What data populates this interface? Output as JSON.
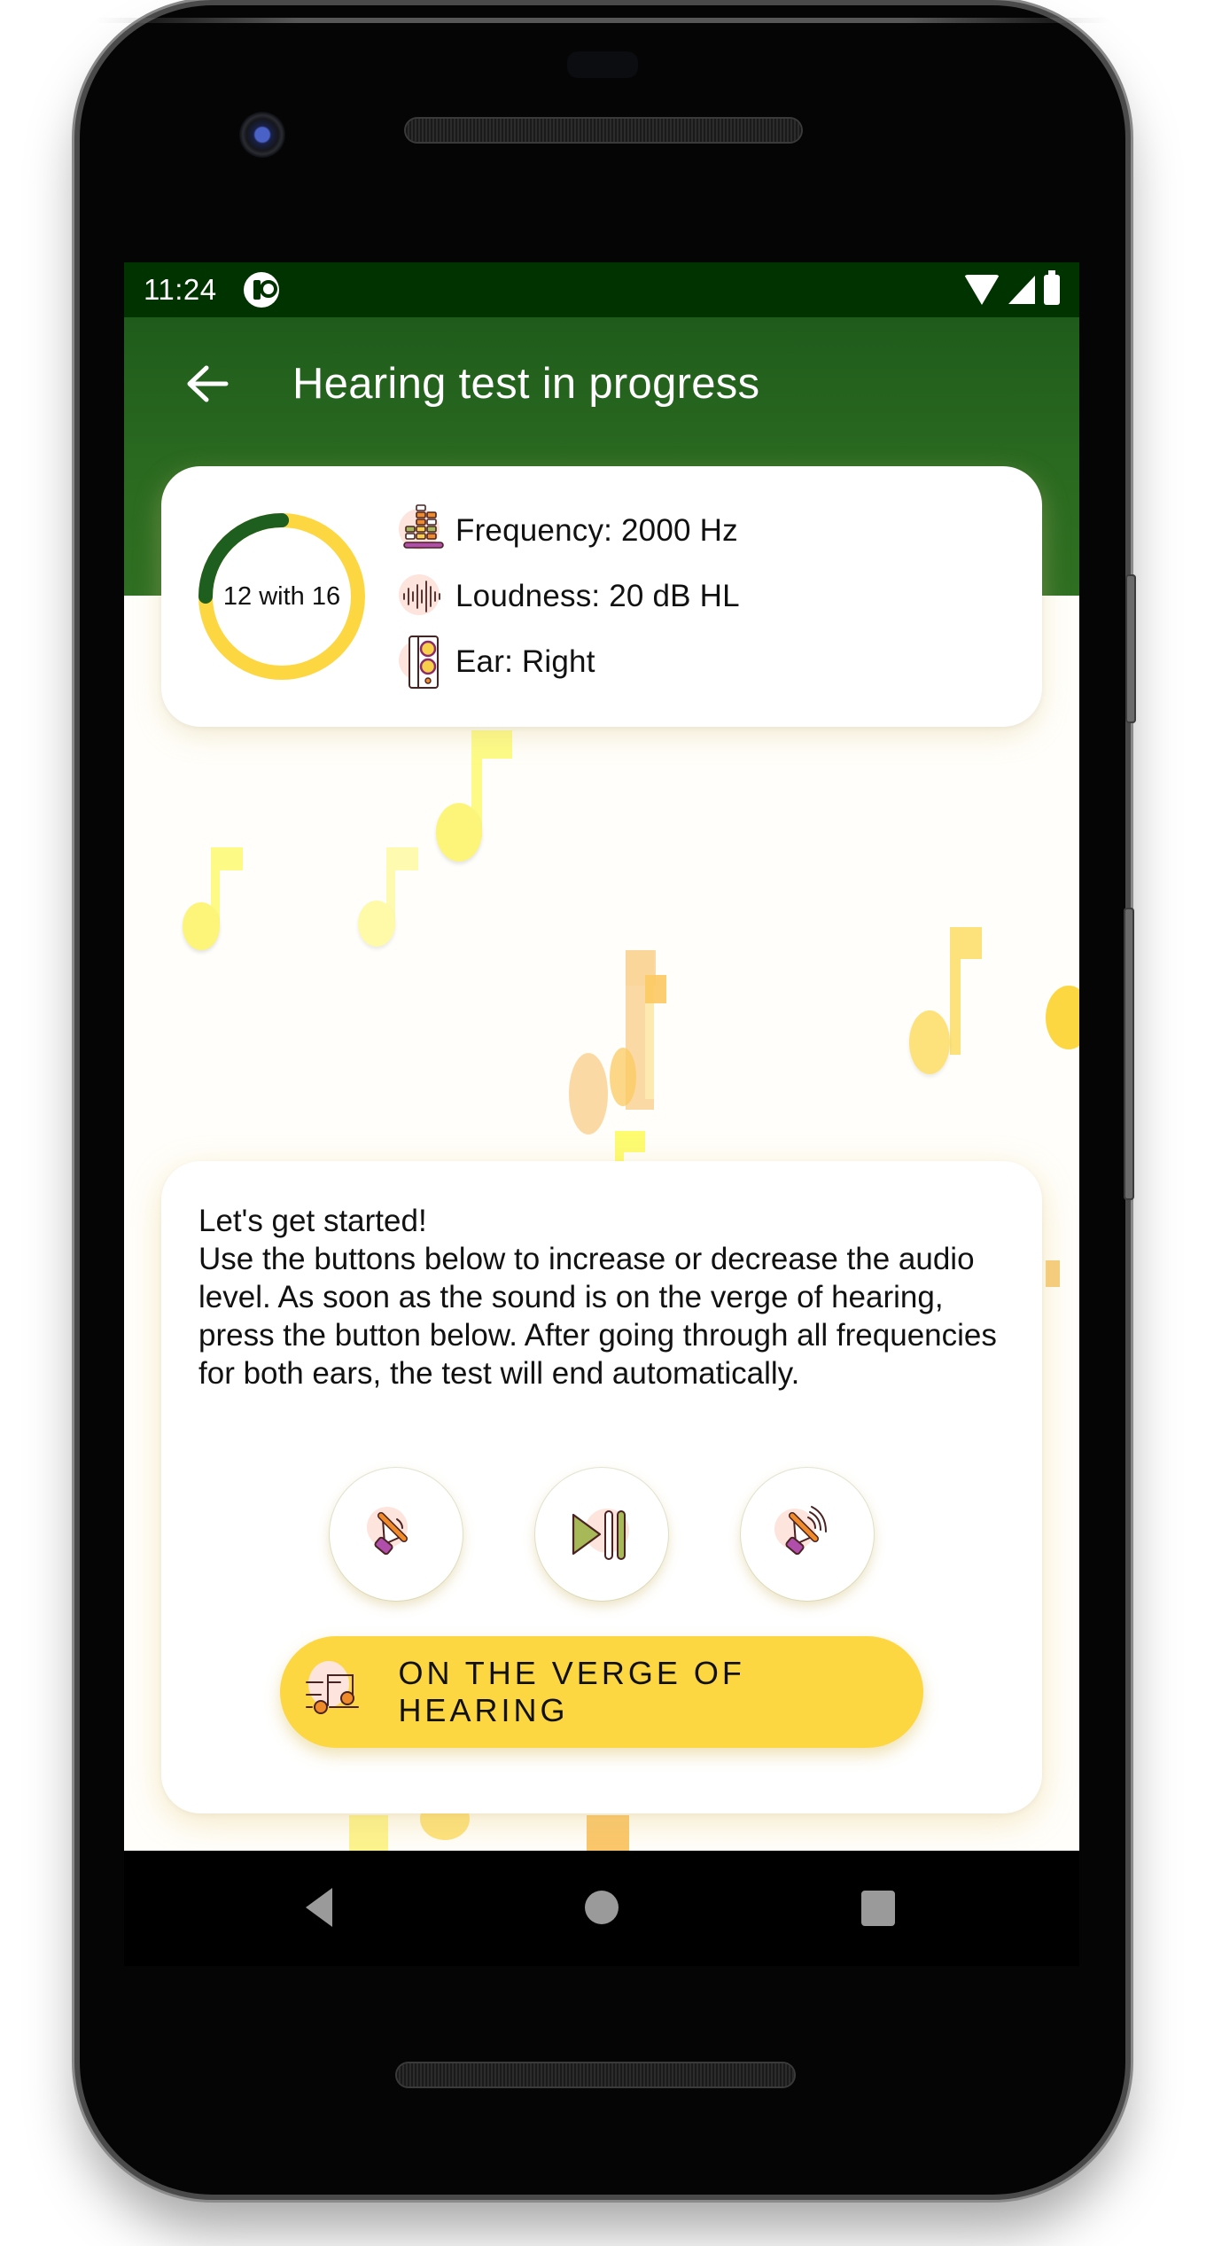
{
  "status_bar": {
    "time": "11:24",
    "icons": [
      "app-notification-icon",
      "wifi-icon",
      "signal-icon",
      "battery-icon"
    ]
  },
  "app_bar": {
    "back_icon": "arrow-left-icon",
    "title": "Hearing test in progress"
  },
  "progress": {
    "label": "12 with 16",
    "current": 12,
    "total": 16,
    "fraction": 0.75,
    "color_done": "#1e5e1e",
    "color_remaining": "#fdd742"
  },
  "info": {
    "items": [
      {
        "icon": "equalizer-icon",
        "text": "Frequency: 2000 Hz"
      },
      {
        "icon": "sound-wave-icon",
        "text": "Loudness: 20 dB HL"
      },
      {
        "icon": "speaker-icon",
        "text": "Ear: Right"
      }
    ]
  },
  "instructions": {
    "text": "Let's get started!\nUse the buttons below to increase or decrease the audio level. As soon as the sound is on the verge of hearing, press the button below. After going through all frequencies for both ears, the test will end automatically."
  },
  "controls": {
    "volume_down_icon": "volume-down-icon",
    "play_pause_icon": "play-pause-icon",
    "volume_up_icon": "volume-up-icon"
  },
  "verge_button": {
    "label": "ON THE VERGE OF HEARING",
    "icon": "music-notes-icon"
  },
  "colors": {
    "app_bar": "#2b6b20",
    "status_bar": "#003300",
    "accent_yellow": "#fdd742",
    "icon_blob": "#fde4dc"
  },
  "nav_bar": {
    "icons": [
      "nav-back-icon",
      "nav-home-icon",
      "nav-recents-icon"
    ]
  }
}
